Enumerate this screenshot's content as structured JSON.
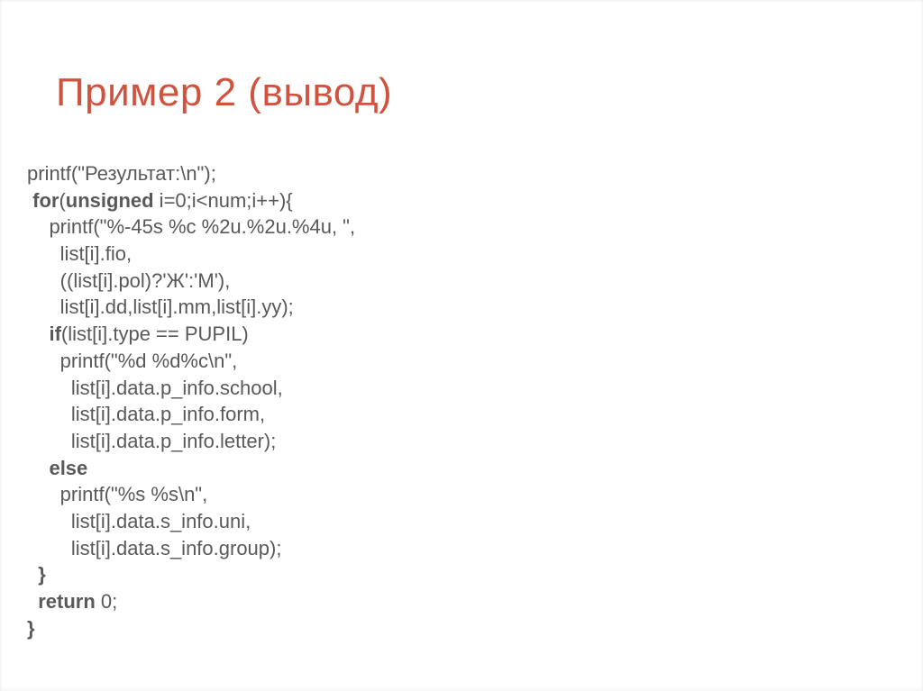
{
  "title": "Пример 2 (вывод)",
  "code": {
    "l1_a": "printf(\"Результат:\\n\");",
    "l2_a": " ",
    "l2_b": "for",
    "l2_c": "(",
    "l2_d": "unsigned",
    "l2_e": " i=0;i<num;i++){",
    "l3_a": "    printf(\"%-45s %c %2u.%2u.%4u, \",",
    "l4_a": "      list[i].fio,",
    "l5_a": "      ((list[i].pol)?'Ж':'М'),",
    "l6_a": "      list[i].dd,list[i].mm,list[i].yy);",
    "l7_a": "    ",
    "l7_b": "if",
    "l7_c": "(list[i].type == PUPIL)",
    "l8_a": "      printf(\"%d %d%c\\n\",",
    "l9_a": "        list[i].data.p_info.school,",
    "l10_a": "        list[i].data.p_info.form,",
    "l11_a": "        list[i].data.p_info.letter);",
    "l12_a": "    ",
    "l12_b": "else",
    "l13_a": "      printf(\"%s %s\\n\",",
    "l14_a": "        list[i].data.s_info.uni,",
    "l15_a": "        list[i].data.s_info.group);",
    "l16_a": "  ",
    "l16_b": "}",
    "l17_a": "  ",
    "l17_b": "return",
    "l17_c": " 0;",
    "l18_a": "}"
  }
}
